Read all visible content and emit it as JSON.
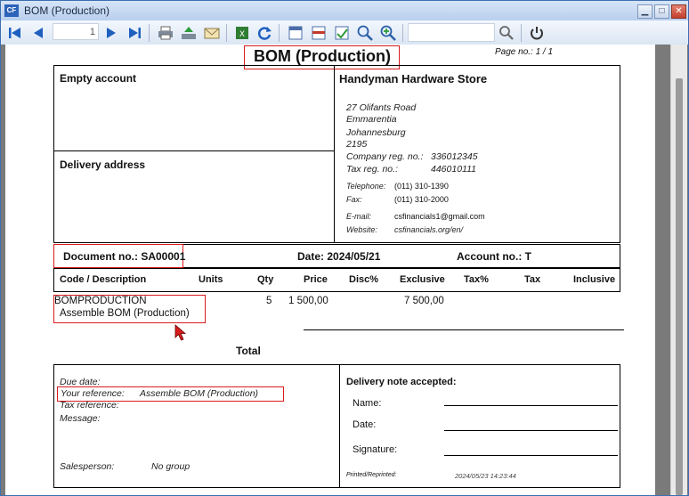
{
  "window": {
    "title": "BOM (Production)",
    "app_icon": "CF",
    "minimize": "▁",
    "maximize": "□",
    "close": "✕"
  },
  "toolbar": {
    "page_input": "1",
    "icons": [
      "first-page-icon",
      "prev-page-icon",
      "next-page-icon",
      "last-page-icon",
      "print-icon",
      "export-icon",
      "email-icon",
      "excel-icon",
      "refresh-icon",
      "layout-1-icon",
      "layout-2-icon",
      "layout-3-icon",
      "zoom-out-icon",
      "zoom-in-icon",
      "search-icon",
      "power-icon"
    ]
  },
  "report": {
    "title": "BOM (Production)",
    "page_label": "Page no.:  1  /  1",
    "account_label": "Empty account",
    "delivery_label": "Delivery address",
    "company": {
      "name": "Handyman Hardware Store",
      "address": [
        "27 Olifants Road",
        "Emmarentia",
        "Johannesburg",
        "2195"
      ],
      "reg_label": "Company reg. no.:",
      "reg_value": "336012345",
      "tax_label": "Tax reg. no.:",
      "tax_value": "446010111",
      "tel_label": "Telephone:",
      "tel_value": "(011) 310-1390",
      "fax_label": "Fax:",
      "fax_value": "(011) 310-2000",
      "email_label": "E-mail:",
      "email_value": "csfinancials1@gmail.com",
      "web_label": "Website:",
      "web_value": "csfinancials.org/en/"
    },
    "doc_no": "Document no.:  SA00001",
    "date": "Date: 2024/05/21",
    "account": "Account no.: T",
    "columns": [
      "Code / Description",
      "Units",
      "Qty",
      "Price",
      "Disc%",
      "Exclusive",
      "Tax%",
      "Tax",
      "Inclusive"
    ],
    "line": {
      "code": "BOMPRODUCTION",
      "description": "Assemble BOM  (Production)",
      "qty": "5",
      "price": "1 500,00",
      "exclusive": "7 500,00"
    },
    "total_label": "Total",
    "footer": {
      "due_date": "Due date:",
      "your_ref_label": "Your reference:",
      "your_ref_value": "Assemble BOM (Production)",
      "tax_ref": "Tax reference:",
      "message": "Message:",
      "salesperson_label": "Salesperson:",
      "salesperson_value": "No group",
      "delivery_accepted": "Delivery note  accepted:",
      "name": "Name:",
      "date": "Date:",
      "signature": "Signature:",
      "printed": "Printed/Reprinted:",
      "printed_stamp": "2024/05/23  14:23:44"
    }
  }
}
